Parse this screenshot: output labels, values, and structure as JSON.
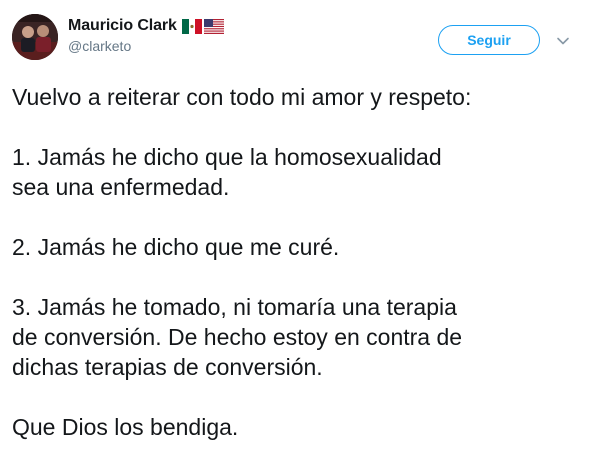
{
  "author": {
    "display_name": "Mauricio Clark",
    "handle": "@clarketo",
    "flags": [
      "mexico-flag",
      "usa-flag"
    ]
  },
  "actions": {
    "follow_label": "Seguir",
    "menu_icon": "chevron-down-icon"
  },
  "colors": {
    "accent": "#1da1f2",
    "text": "#14171a",
    "secondary_text": "#657786"
  },
  "tweet": {
    "paragraphs": [
      [
        "Vuelvo a reiterar con todo mi amor y respeto:"
      ],
      [
        "1. Jamás he dicho que la homosexualidad",
        "sea una enfermedad."
      ],
      [
        "2. Jamás he dicho que me curé."
      ],
      [
        "3. Jamás he tomado, ni tomaría una terapia",
        "de conversión. De hecho estoy en contra de",
        "dichas terapias de conversión."
      ],
      [
        "Que Dios los bendiga."
      ]
    ]
  }
}
